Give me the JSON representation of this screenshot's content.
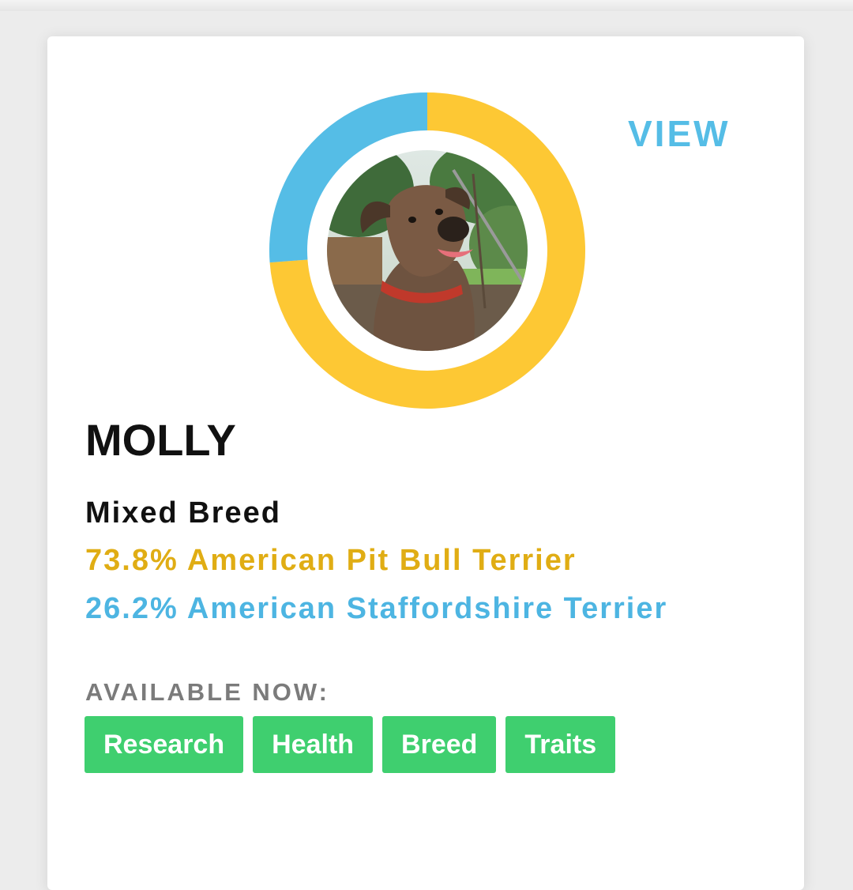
{
  "header": {
    "view_label": "VIEW"
  },
  "dog": {
    "name": "MOLLY",
    "breed_type": "Mixed Breed",
    "breeds": [
      {
        "percent": 73.8,
        "label": "73.8% American Pit Bull Terrier",
        "color": "#fdc834"
      },
      {
        "percent": 26.2,
        "label": "26.2% American Staffordshire Terrier",
        "color": "#55bde6"
      }
    ]
  },
  "availability": {
    "label": "AVAILABLE NOW:",
    "tags": [
      "Research",
      "Health",
      "Breed",
      "Traits"
    ],
    "tag_color": "#3fcf6f"
  },
  "colors": {
    "text_primary": "#111111",
    "breed_1_text": "#e0ad14",
    "breed_2_text": "#4db5e2",
    "muted": "#7b7b7b"
  }
}
